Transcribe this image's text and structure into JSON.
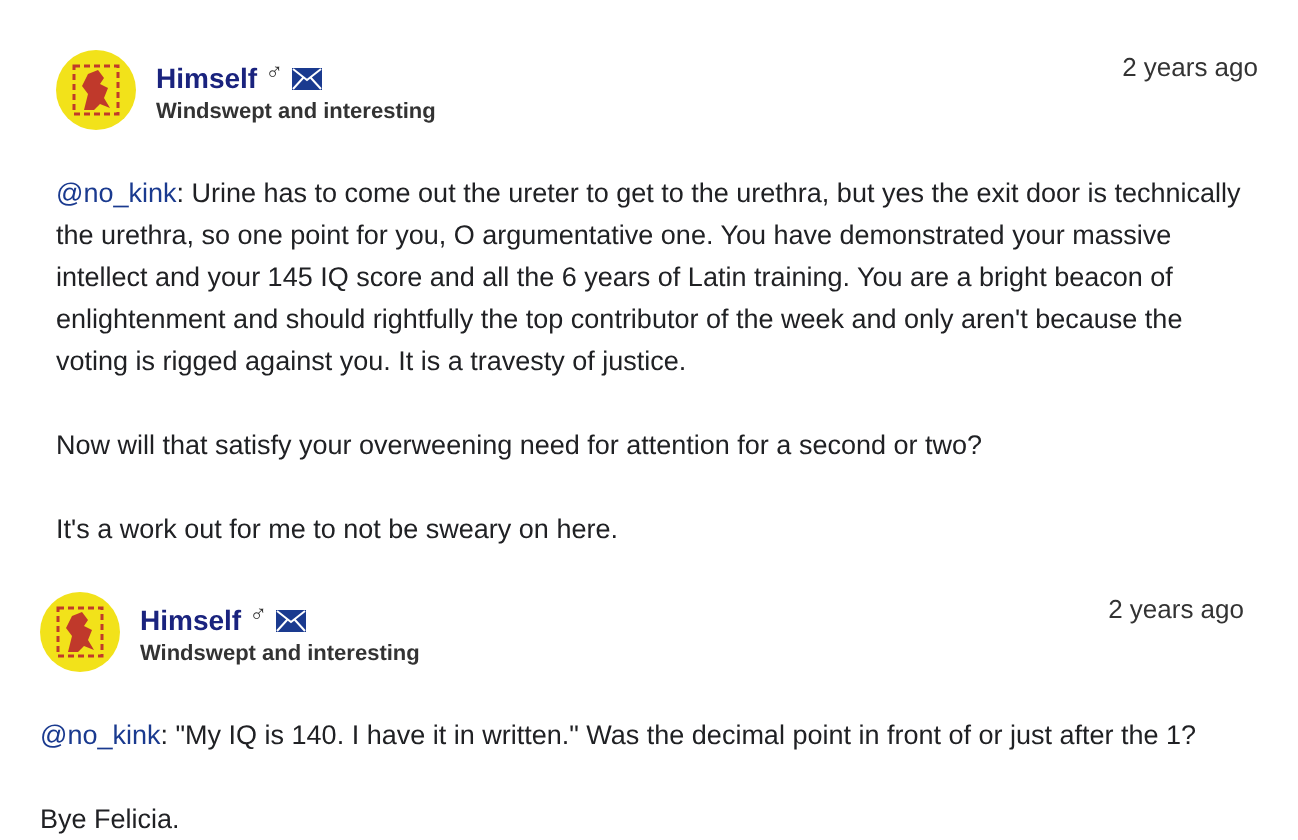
{
  "posts": [
    {
      "author": "Himself",
      "gender_symbol": "♂",
      "tagline": "Windswept and interesting",
      "time": "2 years ago",
      "paragraphs": [
        {
          "mention": "@no_kink",
          "text": ": Urine has to come out the ureter to get to the urethra, but yes the exit door is technically the urethra, so one point for you, O argumentative one. You have demonstrated your massive intellect and your 145 IQ score and all the 6 years of Latin training. You are a bright beacon of enlightenment and should rightfully the top contributor of the week and only aren't because the voting is rigged against you. It is a travesty of justice."
        },
        {
          "text": "Now will that satisfy your overweening need for attention for a second or two?"
        },
        {
          "text": "It's a work out for me to not be sweary on here."
        }
      ]
    },
    {
      "author": "Himself",
      "gender_symbol": "♂",
      "tagline": "Windswept and interesting",
      "time": "2 years ago",
      "paragraphs": [
        {
          "mention": "@no_kink",
          "text": ": \"My IQ is 140. I have it in written.\" Was the decimal point in front of or just after the 1?"
        },
        {
          "text": "Bye Felicia."
        }
      ]
    }
  ]
}
